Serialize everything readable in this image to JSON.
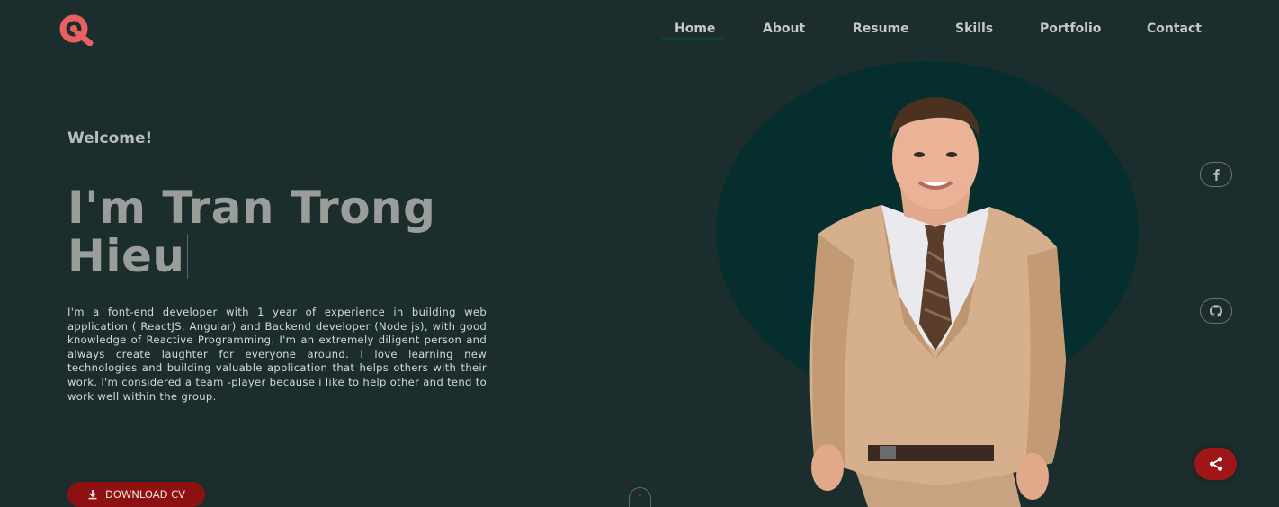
{
  "nav": {
    "items": [
      {
        "label": "Home",
        "active": true
      },
      {
        "label": "About",
        "active": false
      },
      {
        "label": "Resume",
        "active": false
      },
      {
        "label": "Skills",
        "active": false
      },
      {
        "label": "Portfolio",
        "active": false
      },
      {
        "label": "Contact",
        "active": false
      }
    ]
  },
  "hero": {
    "welcome": "Welcome!",
    "headline_line1": "I'm Tran Trong",
    "headline_line2": "Hieu",
    "bio": "I'm a font-end developer with 1 year of experience in building web application ( ReactJS, Angular) and Backend developer (Node js), with good knowledge of Reactive Programming. I'm an extremely diligent person and always create laughter for everyone around. I love learning new technologies and building valuable application that helps others with their work. I'm considered a team -player because i like to help other and tend to work well within the group.",
    "cv_button": "DOWNLOAD CV"
  },
  "icons": {
    "logo": "logo-icon",
    "download": "download-icon",
    "facebook": "facebook-icon",
    "github": "github-icon",
    "share": "share-icon"
  },
  "colors": {
    "background": "#1b2e2d",
    "circle": "#072e2e",
    "accent": "#8d1111",
    "logo": "#e9605f"
  }
}
